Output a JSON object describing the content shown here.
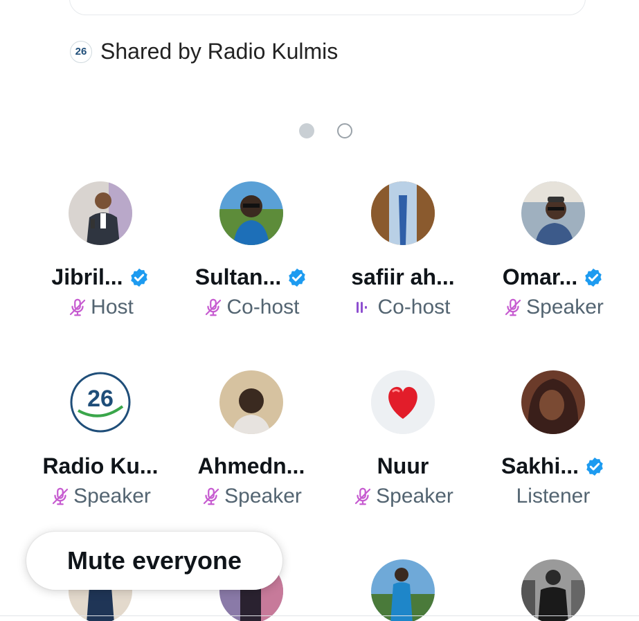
{
  "shared_by": {
    "badge_text": "26",
    "text": "Shared by Radio Kulmis"
  },
  "pagination": {
    "pages": 2,
    "current": 1
  },
  "participants": [
    {
      "name": "Jibril...",
      "verified": true,
      "role": "Host",
      "status_icon": "mic-muted-icon"
    },
    {
      "name": "Sultan...",
      "verified": true,
      "role": "Co-host",
      "status_icon": "mic-muted-icon"
    },
    {
      "name": "safiir ah...",
      "verified": false,
      "role": "Co-host",
      "status_icon": "speaking-icon"
    },
    {
      "name": "Omar...",
      "verified": true,
      "role": "Speaker",
      "status_icon": "mic-muted-icon"
    },
    {
      "name": "Radio Ku...",
      "verified": false,
      "role": "Speaker",
      "status_icon": "mic-muted-icon",
      "avatar_text": "26"
    },
    {
      "name": "Ahmedn...",
      "verified": false,
      "role": "Speaker",
      "status_icon": "mic-muted-icon"
    },
    {
      "name": "Nuur",
      "verified": false,
      "role": "Speaker",
      "status_icon": "mic-muted-icon",
      "avatar_emoji": "❤"
    },
    {
      "name": "Sakhi...",
      "verified": true,
      "role": "Listener",
      "status_icon": "none"
    }
  ],
  "mute_button": {
    "label": "Mute everyone"
  },
  "colors": {
    "verified": "#1d9bf0",
    "mic_muted": "#c65bd0",
    "role_text": "#536471"
  }
}
